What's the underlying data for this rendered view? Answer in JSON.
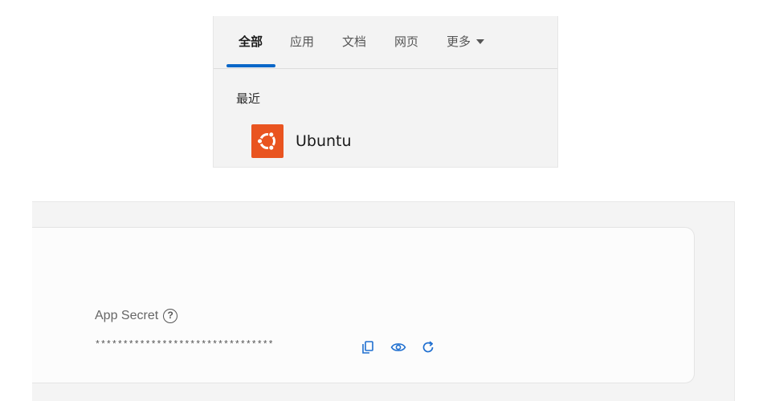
{
  "search_panel": {
    "tabs": [
      {
        "label": "全部",
        "active": true
      },
      {
        "label": "应用"
      },
      {
        "label": "文档"
      },
      {
        "label": "网页"
      },
      {
        "label": "更多"
      }
    ],
    "section_heading": "最近",
    "results": [
      {
        "label": "Ubuntu",
        "icon": "ubuntu-logo"
      }
    ],
    "accent_color": "#0a67c8"
  },
  "credentials": {
    "field_label": "App Secret",
    "help_icon": "question-circle-icon",
    "masked_value": "********************************",
    "actions": [
      "copy-icon",
      "eye-icon",
      "refresh-icon"
    ],
    "action_color": "#1f6fd0"
  }
}
